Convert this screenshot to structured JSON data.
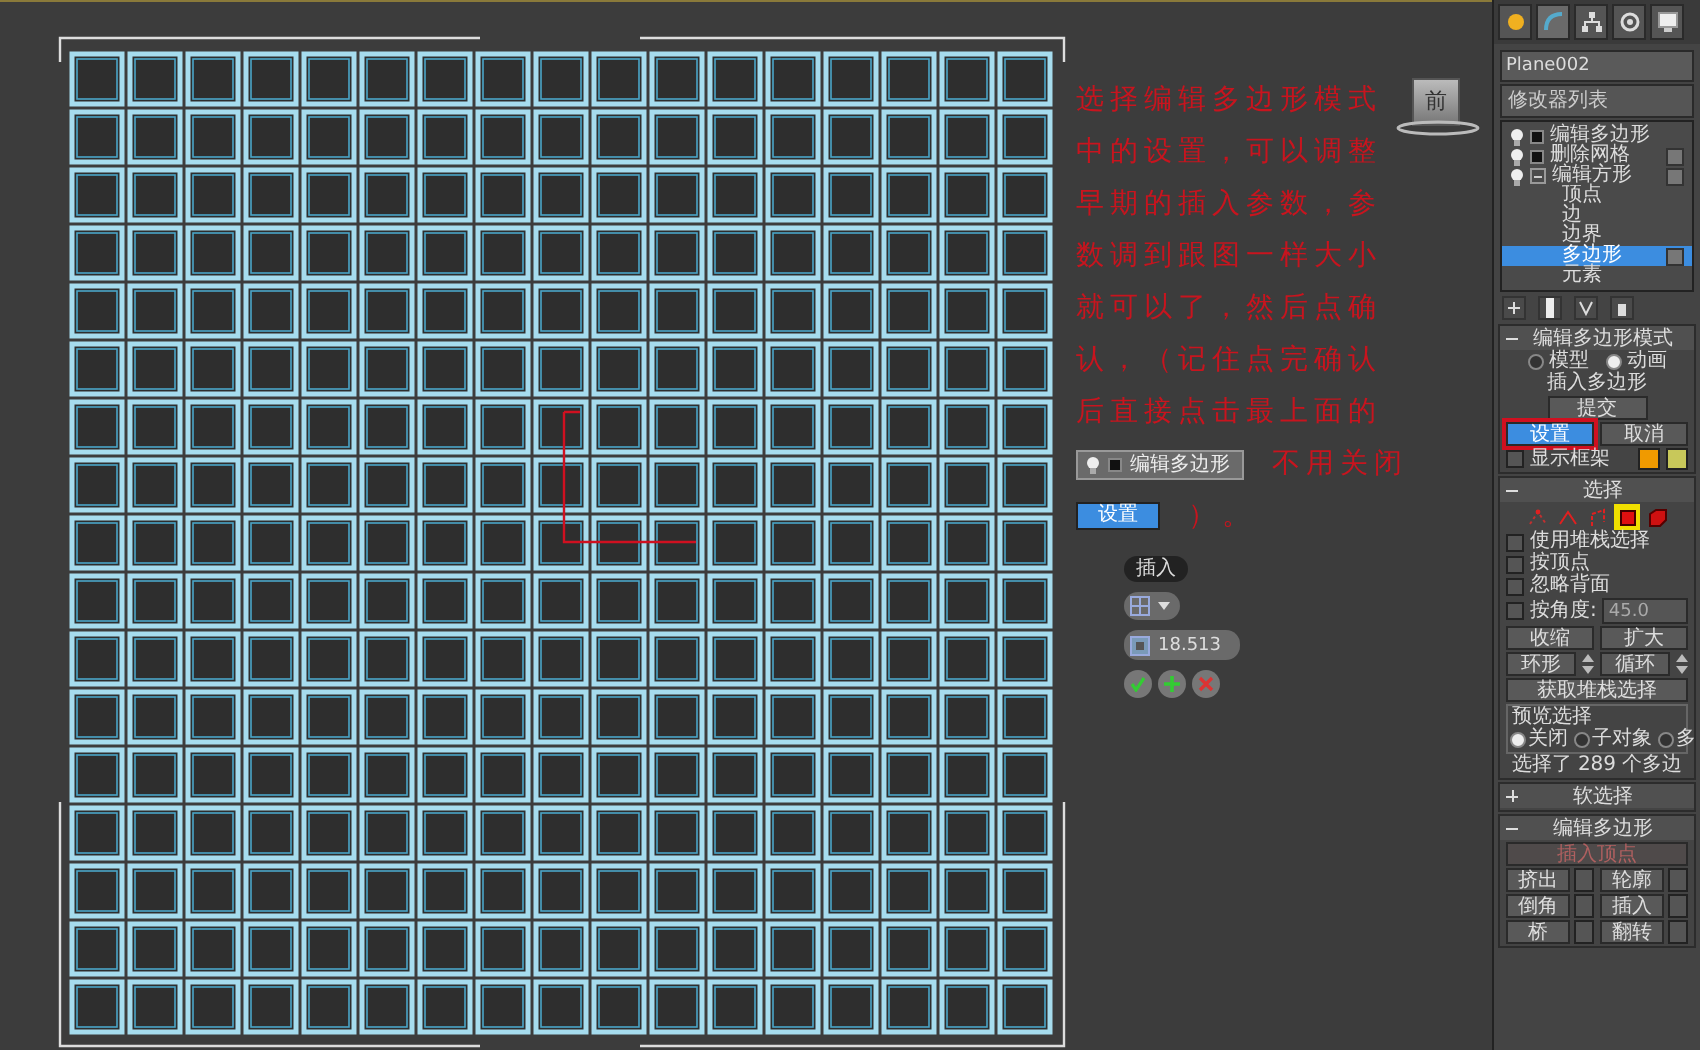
{
  "viewport": {
    "viewcube": {
      "label": "前"
    },
    "annotation": {
      "lines": [
        "选择编辑多边形模式",
        "中的设置，可以调整",
        "早期的插入参数，参",
        "数调到跟图一样大小",
        "就可以了，然后点确",
        "认，（记住点完确认",
        "后直接点击最上面的"
      ],
      "inline_modifier": "编辑多边形",
      "after_modifier": "不用关闭",
      "inline_button": "设置",
      "closing": "）。"
    },
    "caddy": {
      "title": "插入",
      "value": "18.513"
    }
  },
  "panel": {
    "object_name": "Plane002",
    "modifier_list": "修改器列表",
    "stack": [
      {
        "label": "编辑多边形",
        "selected": false,
        "toggle_box": false
      },
      {
        "label": "删除网格",
        "selected": false,
        "toggle_box": true
      },
      {
        "label": "编辑方形",
        "selected": false,
        "toggle_box": true,
        "expanded": true,
        "children": [
          {
            "label": "顶点",
            "selected": false,
            "toggle_box": false
          },
          {
            "label": "边",
            "selected": false,
            "toggle_box": false
          },
          {
            "label": "边界",
            "selected": false,
            "toggle_box": false
          },
          {
            "label": "多边形",
            "selected": true,
            "toggle_box": true
          },
          {
            "label": "元素",
            "selected": false,
            "toggle_box": false
          }
        ]
      }
    ],
    "edit_mode": {
      "title": "编辑多边形模式",
      "expanded": true,
      "modes": [
        {
          "label": "模型",
          "selected": false
        },
        {
          "label": "动画",
          "selected": true
        }
      ],
      "current": "插入多边形",
      "commit": "提交",
      "settings": {
        "label": "设置",
        "highlighted": true
      },
      "cancel": "取消",
      "show_cage": {
        "label": "显示框架",
        "checked": false
      },
      "cage_colors": [
        {
          "color": "#f09a00"
        },
        {
          "color": "#c8c85a"
        }
      ]
    },
    "selection": {
      "title": "选择",
      "expanded": true,
      "levels": [
        {
          "kind": "vertex",
          "selected": false
        },
        {
          "kind": "edge",
          "selected": false
        },
        {
          "kind": "border",
          "selected": false
        },
        {
          "kind": "polygon",
          "selected": true
        },
        {
          "kind": "element",
          "selected": false
        }
      ],
      "options": [
        {
          "label": "使用堆栈选择",
          "checked": false
        },
        {
          "label": "按顶点",
          "checked": false
        },
        {
          "label": "忽略背面",
          "checked": false
        },
        {
          "label": "按角度:",
          "checked": false,
          "value": "45.0"
        }
      ],
      "shrink": "收缩",
      "grow": "扩大",
      "ring": "环形",
      "loop": "循环",
      "get_stack": "获取堆栈选择",
      "preview": {
        "title": "预览选择",
        "options": [
          {
            "label": "关闭",
            "selected": true
          },
          {
            "label": "子对象",
            "selected": false
          },
          {
            "label": "多",
            "selected": false
          }
        ]
      },
      "status": "选择了 289 个多边"
    },
    "soft_selection": {
      "title": "软选择",
      "expanded": false
    },
    "edit_polygons": {
      "title": "编辑多边形",
      "expanded": true,
      "insert_vertex": {
        "label": "插入顶点",
        "disabled": true
      },
      "buttons": [
        {
          "label": "挤出"
        },
        {
          "label": "轮廓"
        },
        {
          "label": "倒角"
        },
        {
          "label": "插入"
        },
        {
          "label": "桥"
        },
        {
          "label": "翻转"
        }
      ]
    }
  }
}
